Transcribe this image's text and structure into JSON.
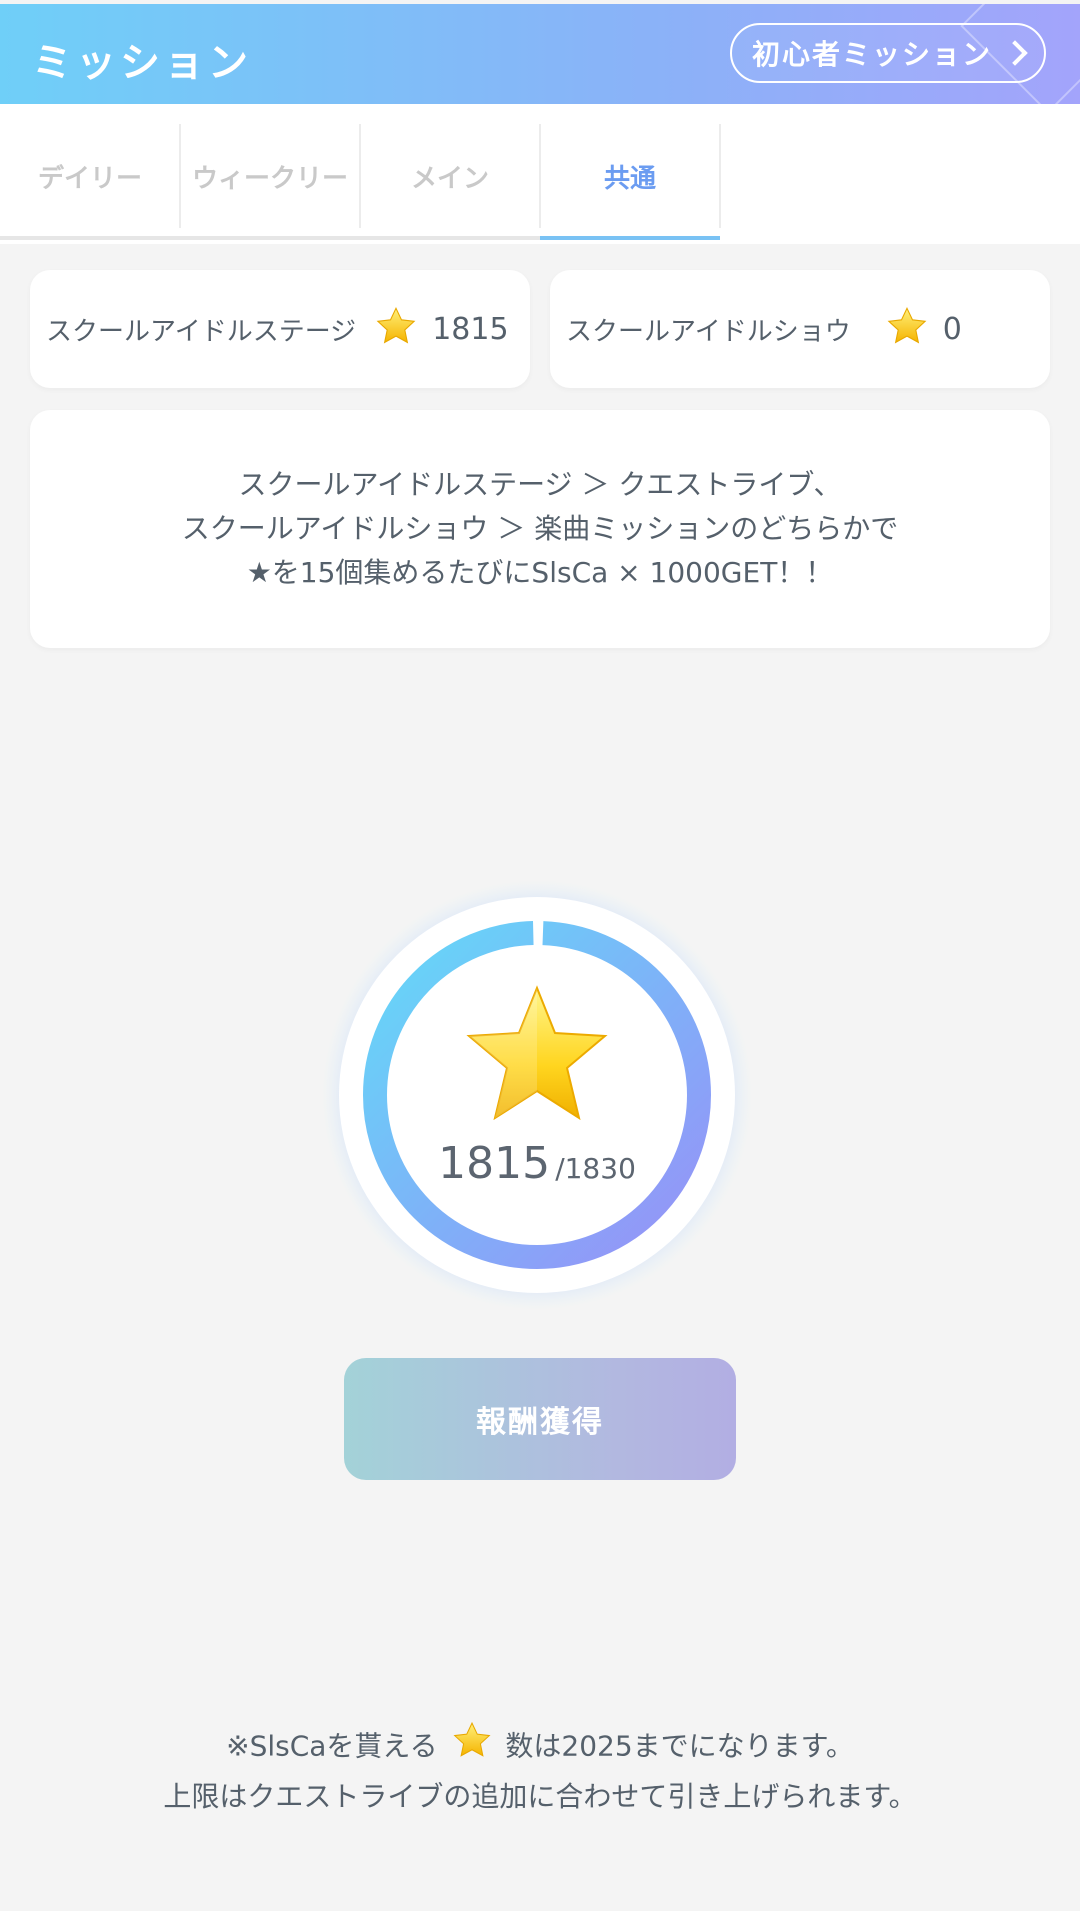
{
  "header": {
    "title": "ミッション",
    "beginner_button": "初心者ミッション"
  },
  "tabs": [
    {
      "label": "デイリー"
    },
    {
      "label": "ウィークリー"
    },
    {
      "label": "メイン"
    },
    {
      "label": "共通",
      "active": true
    }
  ],
  "stats": [
    {
      "label": "スクールアイドルステージ",
      "value": "1815"
    },
    {
      "label": "スクールアイドルショウ",
      "value": "0"
    }
  ],
  "description": {
    "line1": "スクールアイドルステージ ＞ クエストライブ、",
    "line2": "スクールアイドルショウ ＞ 楽曲ミッションのどちらかで",
    "line3": "★を15個集めるたびにSlsCa × 1000GET！！"
  },
  "progress": {
    "current": "1815",
    "total": "/1830",
    "fraction": 0.99
  },
  "claim_button": "報酬獲得",
  "note": {
    "line1_pre": "※SlsCaを貰える",
    "line1_post": "数は2025までになります。",
    "line2": "上限はクエストライブの追加に合わせて引き上げられます。"
  },
  "colors": {
    "accent": "#6b9cf1",
    "header_start": "#6fcff8",
    "header_end": "#a3a4fb",
    "star": "#f8c61c"
  }
}
